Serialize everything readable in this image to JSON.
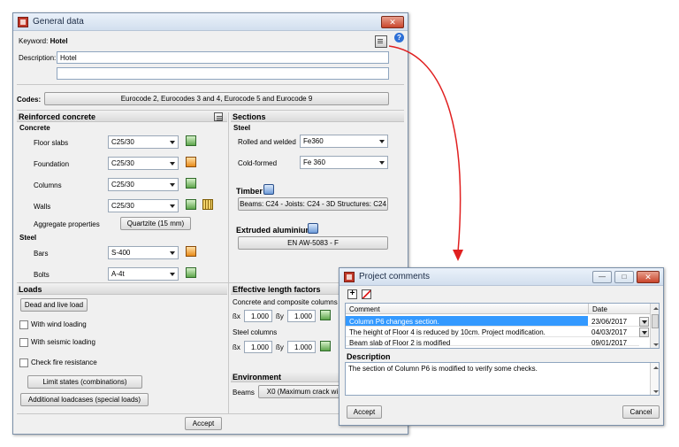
{
  "main": {
    "title": "General data",
    "close": "✕",
    "keyword_label": "Keyword:",
    "keyword_value": "Hotel",
    "description_label": "Description:",
    "description_value": "Hotel",
    "description_line2": "",
    "codes_label": "Codes:",
    "codes_button": "Eurocode 2, Eurocodes 3 and 4, Eurocode 5 and Eurocode 9",
    "accept": "Accept"
  },
  "rc": {
    "header": "Reinforced concrete",
    "concrete": "Concrete",
    "rows": [
      {
        "label": "Floor slabs",
        "value": "C25/30"
      },
      {
        "label": "Foundation",
        "value": "C25/30"
      },
      {
        "label": "Columns",
        "value": "C25/30"
      },
      {
        "label": "Walls",
        "value": "C25/30"
      }
    ],
    "aggregate_label": "Aggregate properties",
    "aggregate_button": "Quartzite (15 mm)",
    "steel": "Steel",
    "bars_label": "Bars",
    "bars_value": "S-400",
    "bolts_label": "Bolts",
    "bolts_value": "A-4t"
  },
  "sections": {
    "header": "Sections",
    "steel": "Steel",
    "rolled_label": "Rolled and welded",
    "rolled_value": "Fe360",
    "cold_label": "Cold-formed",
    "cold_value": "Fe 360",
    "timber_label": "Timber",
    "timber_button": "Beams: C24 - Joists: C24 - 3D Structures: C24",
    "alu_label": "Extruded aluminium",
    "alu_button": "EN AW-5083 - F"
  },
  "loads": {
    "header": "Loads",
    "dead_live": "Dead and live load",
    "wind": "With wind loading",
    "seismic": "With seismic loading",
    "fire": "Check fire resistance",
    "limit_states": "Limit states (combinations)",
    "additional": "Additional loadcases (special loads)"
  },
  "elf": {
    "header": "Effective length factors",
    "concrete_label": "Concrete and composite columns",
    "bx": "ßx",
    "by": "ßy",
    "val1x": "1.000",
    "val1y": "1.000",
    "steel_label": "Steel columns",
    "val2x": "1.000",
    "val2y": "1.000"
  },
  "env": {
    "header": "Environment",
    "beams_label": "Beams",
    "beams_button": "X0 (Maximum crack wi"
  },
  "comments": {
    "title": "Project comments",
    "col_comment": "Comment",
    "col_date": "Date",
    "rows": [
      {
        "comment": "Column P6 changes section.",
        "date": "23/06/2017"
      },
      {
        "comment": "The height of Floor 4 is reduced by 10cm. Project modification.",
        "date": "04/03/2017"
      },
      {
        "comment": "Beam slab of Floor 2 is modified",
        "date": "09/01/2017"
      }
    ],
    "desc_label": "Description",
    "desc_text": "The section of Column P6 is modified to verify some checks.",
    "accept": "Accept",
    "cancel": "Cancel",
    "minimize": "—",
    "maximize": "□",
    "close": "✕"
  },
  "colors": {
    "arrow": "#e02020",
    "selection": "#3399ff"
  }
}
